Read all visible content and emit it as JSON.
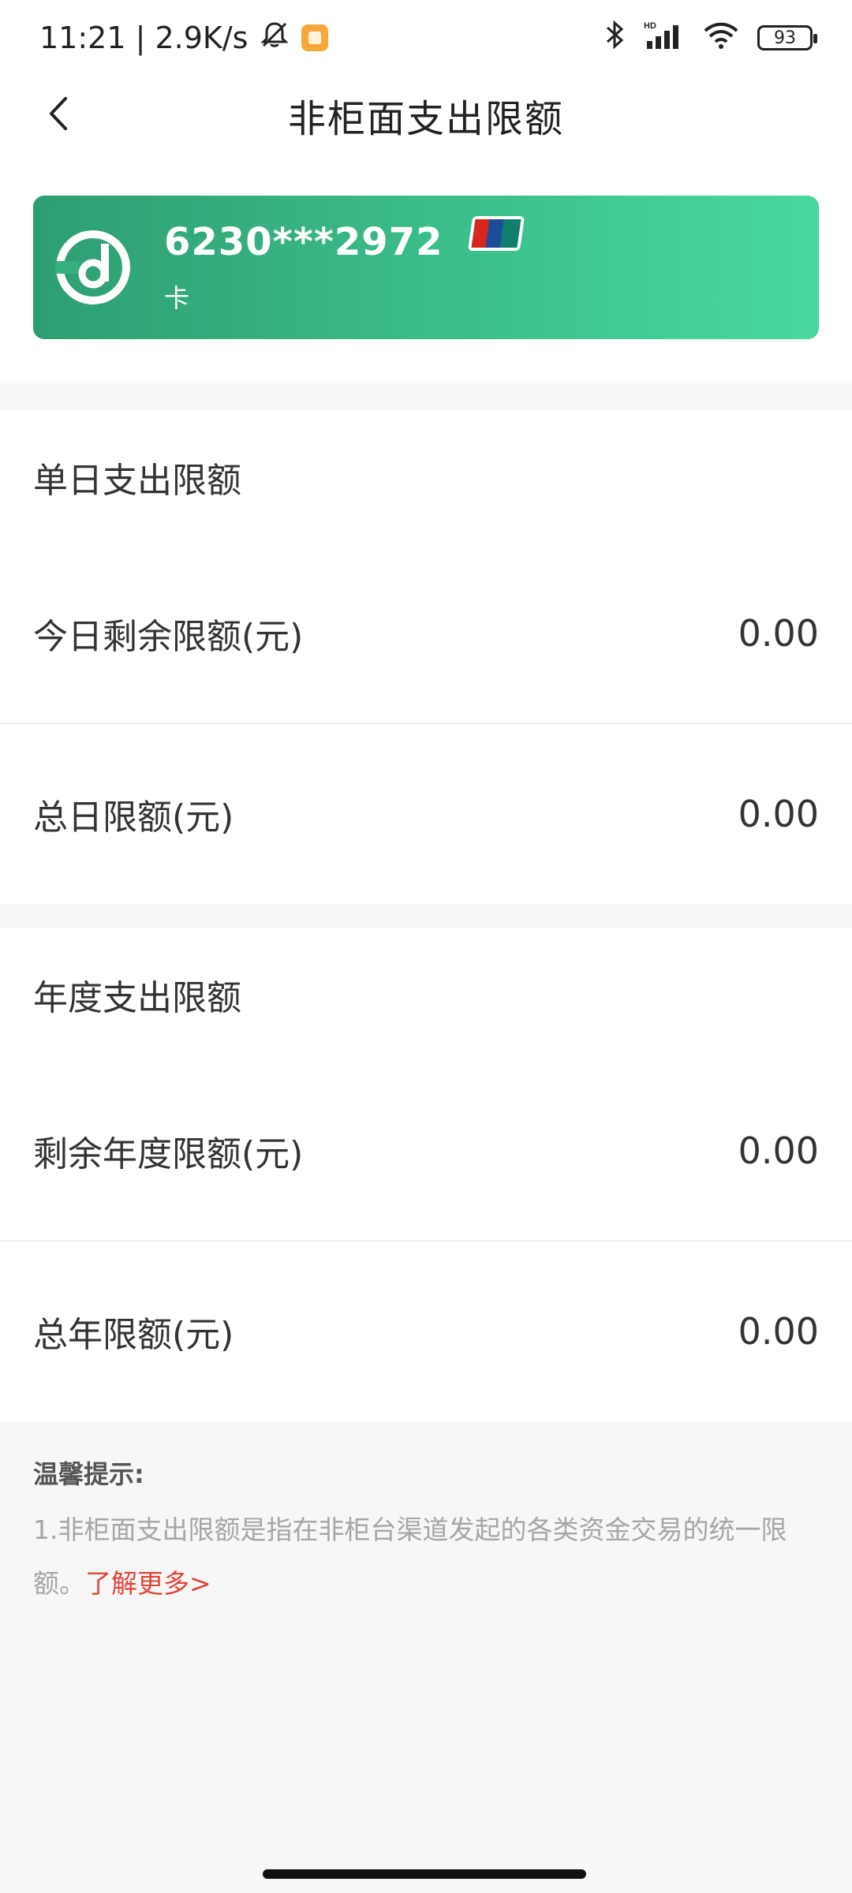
{
  "status_bar": {
    "time_speed": "11:21 | 2.9K/s",
    "battery": "93",
    "icons": [
      "mute-bell-icon",
      "app-notification-icon",
      "bluetooth-icon",
      "signal-icon",
      "wifi-icon",
      "battery-icon"
    ]
  },
  "nav": {
    "title": "非柜面支出限额",
    "back_icon": "chevron-left-icon"
  },
  "card": {
    "number": "6230***2972",
    "type": "卡",
    "colors": {
      "start": "#2e9e72",
      "end": "#48d9a0"
    },
    "network_icon": "unionpay-icon",
    "bank_icon": "bank-logo-icon"
  },
  "daily": {
    "header": "单日支出限额",
    "rows": [
      {
        "label": "今日剩余限额(元)",
        "value": "0.00"
      },
      {
        "label": "总日限额(元)",
        "value": "0.00"
      }
    ]
  },
  "annual": {
    "header": "年度支出限额",
    "rows": [
      {
        "label": "剩余年度限额(元)",
        "value": "0.00"
      },
      {
        "label": "总年限额(元)",
        "value": "0.00"
      }
    ]
  },
  "tips": {
    "title": "温馨提示:",
    "text": "1.非柜面支出限额是指在非柜台渠道发起的各类资金交易的统一限额。",
    "link": "了解更多>",
    "link_color": "#e1453a"
  }
}
